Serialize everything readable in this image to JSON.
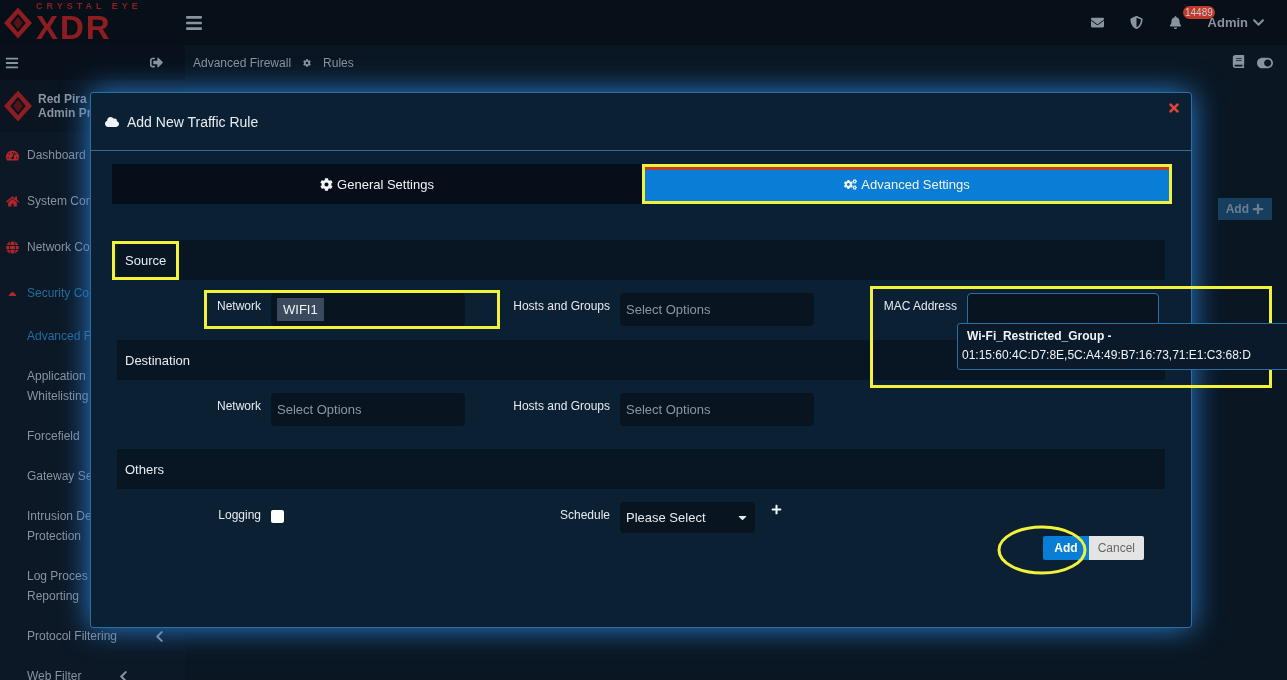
{
  "header": {
    "logo": {
      "tagline": "CRYSTAL EYE",
      "name": "XDR"
    },
    "notifications": "14489",
    "user": "Admin"
  },
  "sidebar": {
    "profile": {
      "name": "Red Pira",
      "role": "Admin Pr"
    },
    "items": [
      {
        "label": "Dashboard",
        "kind": "top",
        "expanded": false
      },
      {
        "label": "System Con",
        "kind": "top",
        "expanded": false
      },
      {
        "label": "Network Co",
        "kind": "top",
        "expanded": false
      },
      {
        "label": "Security Co",
        "kind": "top",
        "expanded": true
      },
      {
        "label": "Advanced F",
        "kind": "sub",
        "selected": true
      },
      {
        "label": "Application Whitelisting",
        "kind": "sub",
        "selected": false
      },
      {
        "label": "Forcefield",
        "kind": "sub",
        "selected": false
      },
      {
        "label": "Gateway Se",
        "kind": "sub",
        "selected": false
      },
      {
        "label": "Intrusion De Protection",
        "kind": "sub",
        "selected": false
      },
      {
        "label": "Log Proces Reporting",
        "kind": "sub",
        "selected": false
      },
      {
        "label": "Protocol Filtering",
        "kind": "group",
        "expanded": false
      },
      {
        "label": "Web Filter",
        "kind": "group",
        "expanded": false
      }
    ]
  },
  "breadcrumb": [
    "Advanced Firewall",
    "Rules"
  ],
  "page": {
    "add_button": "Add"
  },
  "modal": {
    "title": "Add New Traffic Rule",
    "tabs": [
      {
        "label": "General Settings",
        "selected": false,
        "highlighted": false
      },
      {
        "label": "Advanced Settings",
        "selected": true,
        "highlighted": true
      }
    ],
    "sections": [
      {
        "title": "Source",
        "highlighted": true,
        "fields": [
          {
            "label": "Network",
            "kind": "multiselect",
            "chips": [
              "WIFI1"
            ],
            "highlighted": true
          },
          {
            "label": "Hosts and Groups",
            "kind": "multiselect",
            "placeholder": "Select Options",
            "highlighted": false
          },
          {
            "label": "MAC Address",
            "kind": "text",
            "highlighted": true,
            "suggestion": {
              "title": "Wi-Fi_Restricted_Group -",
              "detail": "01:15:60:4C:D7:8E,5C:A4:49:B7:16:73,71:E1:C3:68:D"
            }
          }
        ]
      },
      {
        "title": "Destination",
        "highlighted": false,
        "fields": [
          {
            "label": "Network",
            "kind": "multiselect",
            "placeholder": "Select Options",
            "highlighted": false
          },
          {
            "label": "Hosts and Groups",
            "kind": "multiselect",
            "placeholder": "Select Options",
            "highlighted": false
          }
        ]
      },
      {
        "title": "Others",
        "highlighted": false,
        "fields": [
          {
            "label": "Logging",
            "kind": "checkbox",
            "checked": false,
            "highlighted": false
          },
          {
            "label": "Schedule",
            "kind": "select",
            "value": "Please Select",
            "addable": true,
            "highlighted": false
          }
        ]
      }
    ],
    "buttons": [
      {
        "label": "Add",
        "kind": "primary",
        "highlighted": true
      },
      {
        "label": "Cancel",
        "kind": "secondary",
        "highlighted": false
      }
    ]
  }
}
